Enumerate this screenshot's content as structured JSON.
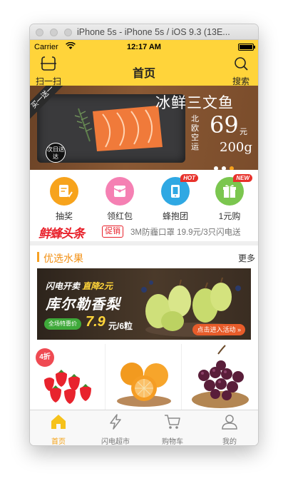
{
  "window": {
    "title": "iPhone 5s - iPhone 5s / iOS 9.3 (13E..."
  },
  "status_bar": {
    "carrier": "Carrier",
    "time": "12:17 AM"
  },
  "nav": {
    "scan_label": "扫一扫",
    "title": "首页",
    "search_label": "搜索"
  },
  "banner": {
    "ribbon": "买一送一",
    "badge": "次日送达",
    "title": "冰鲜三文鱼",
    "origin": "北欧空运",
    "price": "69",
    "unit": "元",
    "weight": "200g",
    "page_count": 3,
    "active_page": 3
  },
  "quick_actions": [
    {
      "label": "抽奖",
      "icon": "lottery-icon",
      "color": "#f7a31c",
      "tag": ""
    },
    {
      "label": "领红包",
      "icon": "red-envelope-icon",
      "color": "#f580b3",
      "tag": ""
    },
    {
      "label": "蜂抱团",
      "icon": "group-buy-icon",
      "color": "#2fa8e3",
      "tag": "HOT"
    },
    {
      "label": "1元购",
      "icon": "gift-icon",
      "color": "#7bc64f",
      "tag": "NEW"
    }
  ],
  "headline": {
    "brand": "鲜蜂头条",
    "tag": "促销",
    "text": "3M防霾口罩 19.9元/3只闪电送"
  },
  "section": {
    "title": "优选水果",
    "more": "更多"
  },
  "promo": {
    "line1_a": "闪电开卖",
    "line1_b": "直降2元",
    "line2": "库尔勒香梨",
    "tag": "全场特惠价",
    "price": "7.9",
    "unit": "元/6粒",
    "cta": "点击进入活动 »"
  },
  "products": [
    {
      "name": "strawberry",
      "discount": "4折"
    },
    {
      "name": "orange",
      "discount": ""
    },
    {
      "name": "grape",
      "discount": ""
    }
  ],
  "tabs": [
    {
      "label": "首页",
      "icon": "home-icon",
      "active": true
    },
    {
      "label": "闪电超市",
      "icon": "lightning-icon",
      "active": false
    },
    {
      "label": "购物车",
      "icon": "cart-icon",
      "active": false
    },
    {
      "label": "我的",
      "icon": "profile-icon",
      "active": false
    }
  ],
  "colors": {
    "accent": "#ffd43a",
    "active_tab": "#f4a114",
    "brand_red": "#e8202a",
    "section_orange": "#f29014"
  }
}
